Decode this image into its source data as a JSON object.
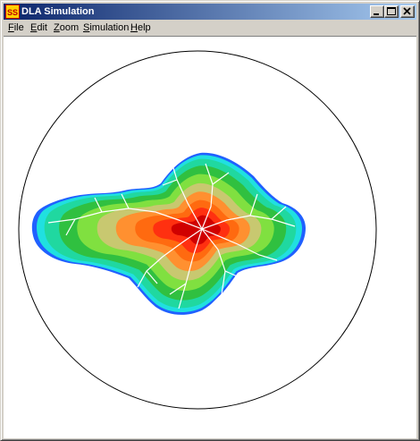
{
  "window": {
    "title": "DLA Simulation",
    "app_icon": "ss-app-icon",
    "controls": [
      "minimize-icon",
      "maximize-icon",
      "close-icon"
    ]
  },
  "menu": {
    "items": [
      {
        "mnemonic": "F",
        "rest": "ile"
      },
      {
        "mnemonic": "E",
        "rest": "dit"
      },
      {
        "mnemonic": "Z",
        "rest": "oom"
      },
      {
        "mnemonic": "S",
        "rest": "imulation"
      },
      {
        "mnemonic": "H",
        "rest": "elp"
      }
    ]
  },
  "canvas": {
    "background": "#ffffff",
    "boundary_color": "#000000",
    "color_bands": [
      "#2060ff",
      "#20e0e0",
      "#20d8a0",
      "#30c040",
      "#80e040",
      "#c8c870",
      "#ff9030",
      "#ff6a10",
      "#ff3010",
      "#d00000"
    ],
    "strand_color": "#ffffff"
  }
}
